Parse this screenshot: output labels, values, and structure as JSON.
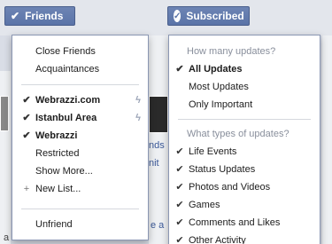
{
  "background": {
    "links": [
      "nds",
      "nit",
      "e a"
    ],
    "texts": [
      "a"
    ]
  },
  "friends_button": {
    "label": "Friends",
    "icon": "check-icon"
  },
  "subscribed_button": {
    "label": "Subscribed",
    "icon": "check-circle-icon"
  },
  "friends_menu": {
    "group1": [
      "Close Friends",
      "Acquaintances"
    ],
    "lists": [
      {
        "label": "Webrazzi.com",
        "checked": true,
        "bold": true,
        "smart": true
      },
      {
        "label": "Istanbul Area",
        "checked": true,
        "bold": true,
        "smart": true
      },
      {
        "label": "Webrazzi",
        "checked": true,
        "bold": true,
        "smart": false
      },
      {
        "label": "Restricted",
        "checked": false,
        "bold": false,
        "smart": false
      },
      {
        "label": "Show More...",
        "checked": false,
        "bold": false,
        "smart": false
      }
    ],
    "new_list": "New List...",
    "unfriend": "Unfriend"
  },
  "subscribed_menu": {
    "updates_heading": "How many updates?",
    "updates": [
      {
        "label": "All Updates",
        "checked": true,
        "bold": true
      },
      {
        "label": "Most Updates",
        "checked": false,
        "bold": false
      },
      {
        "label": "Only Important",
        "checked": false,
        "bold": false
      }
    ],
    "types_heading": "What types of updates?",
    "types": [
      {
        "label": "Life Events",
        "checked": true
      },
      {
        "label": "Status Updates",
        "checked": true
      },
      {
        "label": "Photos and Videos",
        "checked": true
      },
      {
        "label": "Games",
        "checked": true
      },
      {
        "label": "Comments and Likes",
        "checked": true
      },
      {
        "label": "Other Activity",
        "checked": true
      }
    ]
  },
  "colors": {
    "button_blue": "#5b74a8",
    "link_blue": "#3b5998",
    "heading_gray": "#898f9c"
  }
}
